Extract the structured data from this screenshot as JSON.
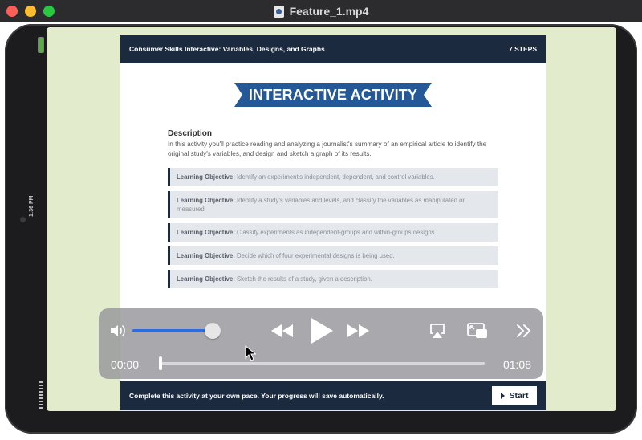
{
  "window": {
    "title": "Feature_1.mp4"
  },
  "tablet": {
    "status_time": "1:36 PM"
  },
  "activity": {
    "header_title": "Consumer Skills Interactive: Variables, Designs, and Graphs",
    "steps": "7 STEPS",
    "banner": "INTERACTIVE ACTIVITY",
    "description_heading": "Description",
    "description_text": "In this activity you'll practice reading and analyzing a journalist's summary of an empirical article to identify the original study's variables, and design and sketch a graph of its results.",
    "objective_label": "Learning Objective:",
    "objectives": [
      "Identify an experiment's independent, dependent, and control variables.",
      "Identify a study's variables and levels, and classify the variables as manipulated or measured.",
      "Classify experiments as independent-groups and within-groups designs.",
      "Decide which of four experimental designs is being used.",
      "Sketch the results of a study, given a description."
    ],
    "footer_text": "Complete this activity at your own pace. Your progress will save automatically.",
    "start_label": "Start"
  },
  "player": {
    "current_time": "00:00",
    "duration": "01:08",
    "volume_fraction": 0.85,
    "progress_fraction": 0.0
  },
  "colors": {
    "navy": "#1b2a3f",
    "banner_blue": "#245896",
    "screen_bg": "#e3ebcd",
    "volume_blue": "#2d6be0"
  },
  "icons": [
    "volume-icon",
    "rewind-icon",
    "play-icon",
    "fast-forward-icon",
    "airplay-icon",
    "picture-in-picture-icon",
    "more-icon"
  ]
}
